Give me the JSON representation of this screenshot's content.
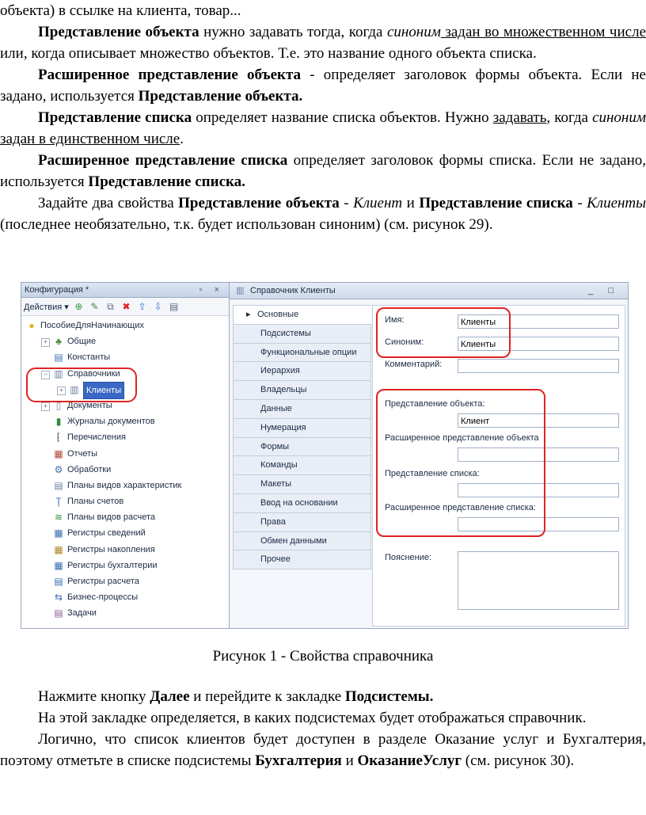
{
  "text_top": {
    "line0": "объекта) в ссылке на клиента, товар...",
    "p1_bold": "Представление объекта",
    "p1_a": " нужно задавать тогда, когда ",
    "p1_ital": "синоним",
    "p1_u": " задан во множественном числе",
    "p1_b": " или, когда описывает множество объектов. Т.е. это название одного объекта списка.",
    "p2_bold": "Расширенное представление объекта",
    "p2_a": " - определяет заголовок формы объекта. Если не задано, используется ",
    "p2_bold2": "Представление объекта.",
    "p3_bold": "Представление списка",
    "p3_a": " определяет название списка объектов. Нужно ",
    "p3_u1": "задавать",
    "p3_b": ", когда ",
    "p3_ital": "синоним",
    "p3_u2": " задан в единственном числе",
    "p3_c": ".",
    "p4_bold": "Расширенное представление списка",
    "p4_a": " определяет заголовок формы списка. Если не задано, используется ",
    "p4_bold2": "Представление списка.",
    "p5_a": "Задайте два свойства ",
    "p5_bold1": "Представление объекта",
    "p5_b": " - ",
    "p5_ital1": "Клиент",
    "p5_c": " и ",
    "p5_bold2": "Представление списка",
    "p5_d": " - ",
    "p5_ital2": "Клиенты",
    "p5_e": " (последнее необязательно, т.к. будет использован синоним) (см. рисунок 29)."
  },
  "figure": {
    "left_panel": {
      "title": "Конфигурация *",
      "controls": "▫ ×",
      "actions_label": "Действия ▾",
      "tree": [
        {
          "label": "ПособиеДляНачинающих",
          "icon": "config-icon",
          "glyph": "●",
          "color": "#e0b020"
        },
        {
          "label": "Общие",
          "icon": "common-icon",
          "glyph": "♣",
          "color": "#4a8a3a"
        },
        {
          "label": "Константы",
          "icon": "constants-icon",
          "glyph": "▤",
          "color": "#3a6fb0"
        },
        {
          "label": "Справочники",
          "icon": "catalogs-icon",
          "glyph": "▥",
          "color": "#6a7fa6"
        },
        {
          "label": "Клиенты",
          "icon": "catalog-item-icon",
          "glyph": "▥",
          "color": "#6a7fa6"
        },
        {
          "label": "Документы",
          "icon": "documents-icon",
          "glyph": "▯",
          "color": "#6a7fa6"
        },
        {
          "label": "Журналы документов",
          "icon": "journals-icon",
          "glyph": "▮",
          "color": "#2e8a3a"
        },
        {
          "label": "Перечисления",
          "icon": "enums-icon",
          "glyph": "⁅",
          "color": "#555"
        },
        {
          "label": "Отчеты",
          "icon": "reports-icon",
          "glyph": "▦",
          "color": "#b04a3a"
        },
        {
          "label": "Обработки",
          "icon": "processing-icon",
          "glyph": "⚙",
          "color": "#3a6fb0"
        },
        {
          "label": "Планы видов характеристик",
          "icon": "chart-char-icon",
          "glyph": "▤",
          "color": "#6a7fa6"
        },
        {
          "label": "Планы счетов",
          "icon": "chart-accounts-icon",
          "glyph": "Ţ",
          "color": "#3a6fb0"
        },
        {
          "label": "Планы видов расчета",
          "icon": "chart-calc-icon",
          "glyph": "≋",
          "color": "#2e8a3a"
        },
        {
          "label": "Регистры сведений",
          "icon": "info-registers-icon",
          "glyph": "▦",
          "color": "#3a6fb0"
        },
        {
          "label": "Регистры накопления",
          "icon": "accum-registers-icon",
          "glyph": "▦",
          "color": "#b08a2a"
        },
        {
          "label": "Регистры бухгалтерии",
          "icon": "account-registers-icon",
          "glyph": "▦",
          "color": "#3a6fb0"
        },
        {
          "label": "Регистры расчета",
          "icon": "calc-registers-icon",
          "glyph": "▤",
          "color": "#3a6fb0"
        },
        {
          "label": "Бизнес-процессы",
          "icon": "business-process-icon",
          "glyph": "⇆",
          "color": "#3a6fb0"
        },
        {
          "label": "Задачи",
          "icon": "tasks-icon",
          "glyph": "▤",
          "color": "#8a5a9a"
        }
      ]
    },
    "right_panel": {
      "title": "Справочник Клиенты",
      "controls": "_ □",
      "tabs": [
        "Основные",
        "Подсистемы",
        "Функциональные опции",
        "Иерархия",
        "Владельцы",
        "Данные",
        "Нумерация",
        "Формы",
        "Команды",
        "Макеты",
        "Ввод на основании",
        "Права",
        "Обмен данными",
        "Прочее"
      ],
      "fields": {
        "name_label": "Имя:",
        "name_value": "Клиенты",
        "synonym_label": "Синоним:",
        "synonym_value": "Клиенты",
        "comment_label": "Комментарий:",
        "comment_value": "",
        "obj_repr_label": "Представление объекта:",
        "obj_repr_value": "Клиент",
        "ext_obj_repr_label": "Расширенное представление объекта",
        "ext_obj_repr_value": "",
        "list_repr_label": "Представление списка:",
        "list_repr_value": "",
        "ext_list_repr_label": "Расширенное представление списка:",
        "ext_list_repr_value": "",
        "explanation_label": "Пояснение:",
        "explanation_value": ""
      }
    },
    "highlight_color": "#e02323"
  },
  "caption": "Рисунок 1 - Свойства справочника",
  "text_bottom": {
    "p6_a": "Нажмите кнопку ",
    "p6_bold1": "Далее",
    "p6_b": " и перейдите к закладке ",
    "p6_bold2": "Подсистемы.",
    "p7": "На этой закладке определяется, в каких подсистемах будет отображаться справочник.",
    "p8_a": "Логично, что список клиентов будет доступен в разделе Оказание услуг и Бухгалтерия, поэтому отметьте в списке подсистемы ",
    "p8_bold1": "Бухгалтерия",
    "p8_b": " и ",
    "p8_bold2": "ОказаниеУслуг",
    "p8_c": " (см. рисунок 30)."
  }
}
